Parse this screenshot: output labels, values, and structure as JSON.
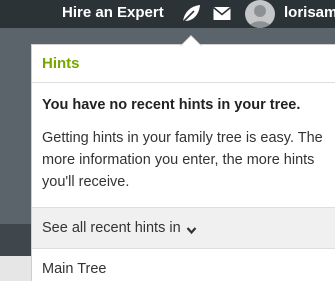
{
  "header": {
    "hire_expert_label": "Hire an Expert",
    "hints_icon": "leaf-icon",
    "messages_icon": "envelope-icon",
    "username": "lorisam"
  },
  "hints_popover": {
    "title": "Hints",
    "empty_heading": "You have no recent hints in your tree.",
    "empty_body": "Getting hints in your family tree is easy. The more information you enter, the more hints you'll receive.",
    "see_all_label": "See all recent hints in",
    "trees": [
      "Main Tree"
    ]
  },
  "colors": {
    "topbar": "#2c3337",
    "hints_title": "#7aa500",
    "backdrop": "#5b646a"
  }
}
